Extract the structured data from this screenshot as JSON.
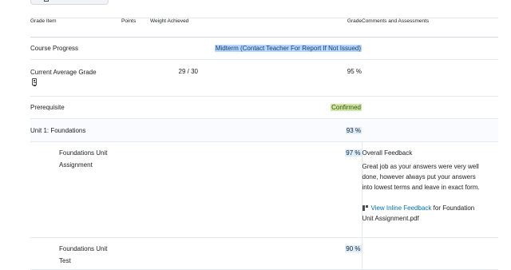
{
  "columns": {
    "item": "Grade Item",
    "points": "Points",
    "weight": "Weight Achieved",
    "grade": "Grade",
    "comments": "Comments and Assessments"
  },
  "rows": {
    "course_progress": {
      "item": "Course Progress",
      "grade": "Midterm (Contact Teacher For Report If Not Issued)"
    },
    "current_average": {
      "item": "Current Average Grade",
      "icon": "calculator-icon",
      "weight": "29 / 30",
      "grade": "95 %"
    },
    "prerequisite": {
      "item": "Prerequisite",
      "grade": "Confirmed"
    },
    "unit1": {
      "item": "Unit 1: Foundations",
      "grade": "93 %"
    },
    "assignment": {
      "item_line1": "Foundations Unit",
      "item_line2": "Assignment",
      "grade": "97 %",
      "feedback_title": "Overall Feedback",
      "feedback_line1": "Great job as your answers were very well",
      "feedback_line2": "done, however always put your answers",
      "feedback_line3": "into lowest terms and leave in exact form.",
      "inline_link": "View Inline Feedback",
      "inline_suffix": "for Foundation",
      "inline_file": "Unit Assignment.pdf",
      "inline_icon": "inline-feedback-icon"
    },
    "test": {
      "item_line1": "Foundations Unit",
      "item_line2": "Test",
      "grade": "90 %"
    }
  },
  "colors": {
    "link": "#006fbf",
    "highlight_blue": "#b3d7ff",
    "highlight_green": "#cfe8a0",
    "row_shade": "#f9fbff",
    "border": "#e3e9f1"
  }
}
